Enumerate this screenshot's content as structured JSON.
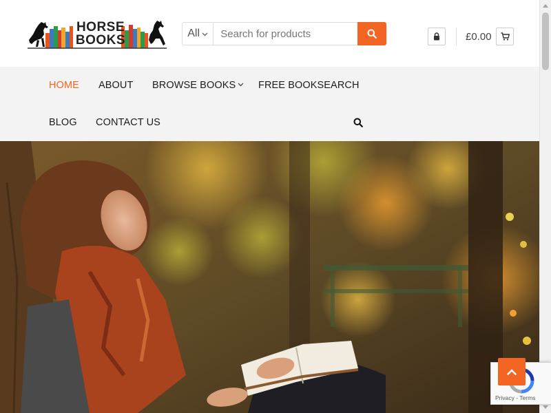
{
  "brand": {
    "logo_line1": "HORSE",
    "logo_line2": "BOOKS",
    "accent_color": "#f26522"
  },
  "search": {
    "category": "All",
    "placeholder": "Search for products",
    "button_icon": "search-icon"
  },
  "account": {
    "icon": "lock-icon"
  },
  "cart": {
    "total": "£0.00",
    "icon": "cart-icon"
  },
  "nav": {
    "items": [
      {
        "label": "HOME",
        "active": true
      },
      {
        "label": "ABOUT"
      },
      {
        "label": "BROWSE BOOKS",
        "dropdown": true
      },
      {
        "label": "FREE BOOKSEARCH"
      },
      {
        "label": "BLOG"
      },
      {
        "label": "CONTACT US"
      }
    ],
    "search_icon": "search-icon"
  },
  "hero": {
    "image": "woman-reading-book-autumn-park"
  },
  "recaptcha": {
    "privacy": "Privacy",
    "separator": " - ",
    "terms": "Terms"
  },
  "back_to_top": {
    "icon": "chevron-up-icon"
  }
}
